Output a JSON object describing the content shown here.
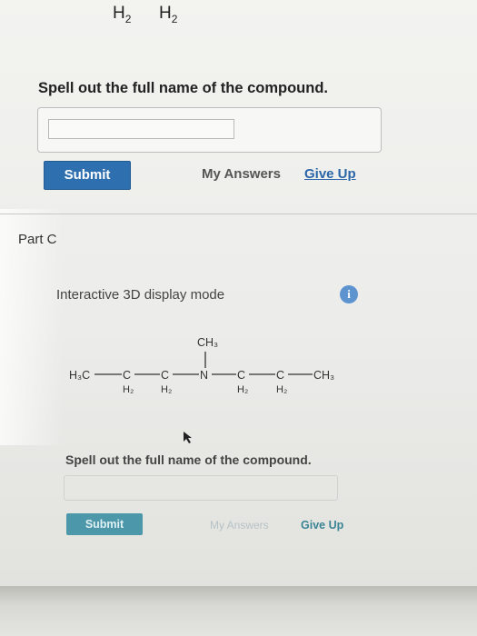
{
  "top_formula": {
    "h2_left": "H",
    "h2_left_sub": "2",
    "h2_right": "H",
    "h2_right_sub": "2"
  },
  "part_b": {
    "question": "Spell out the full name of the compound.",
    "answer_value": "",
    "submit_label": "Submit",
    "my_answers_label": "My Answers",
    "give_up_label": "Give Up"
  },
  "part_c": {
    "label": "Part C",
    "mode_label": "Interactive 3D display mode",
    "info_icon": "info-icon",
    "molecule": {
      "h3c": "H₃C",
      "c": "C",
      "n": "N",
      "ch3": "CH₃",
      "h2": "H₂"
    },
    "question": "Spell out the full name of the compound.",
    "submit_label": "Submit",
    "my_answers_label": "My Answers",
    "give_up_label": "Give Up"
  },
  "colors": {
    "accent": "#2e6fb0",
    "link": "#2a65a8"
  }
}
